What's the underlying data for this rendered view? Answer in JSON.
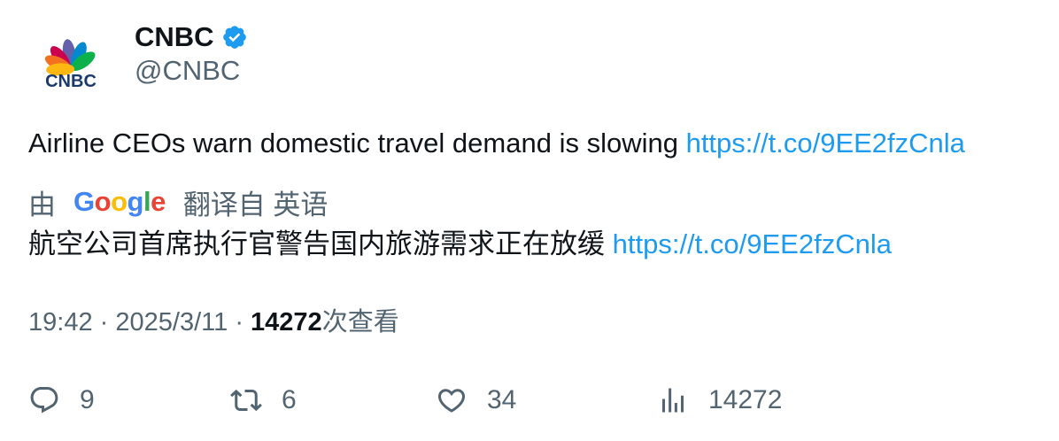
{
  "author": {
    "display_name": "CNBC",
    "handle": "@CNBC",
    "logo_text": "CNBC",
    "verified": true
  },
  "tweet": {
    "text": "Airline CEOs warn domestic travel demand is slowing",
    "link": "https://t.co/9EE2fzCnla"
  },
  "translation": {
    "prefix": "由",
    "provider": "Google",
    "suffix": "翻译自 英语",
    "text": "航空公司首席执行官警告国内旅游需求正在放缓",
    "link": "https://t.co/9EE2fzCnla"
  },
  "meta": {
    "time": "19:42",
    "separator": "·",
    "date": "2025/3/11",
    "views_count": "14272",
    "views_label": "次查看"
  },
  "actions": {
    "replies": "9",
    "retweets": "6",
    "likes": "34",
    "views": "14272"
  },
  "colors": {
    "link": "#1d9bf0",
    "secondary_text": "#536471",
    "primary_text": "#0f1419",
    "verified": "#1d9bf0"
  },
  "icons": [
    "verified-badge-icon",
    "reply-icon",
    "retweet-icon",
    "like-icon",
    "views-icon"
  ]
}
